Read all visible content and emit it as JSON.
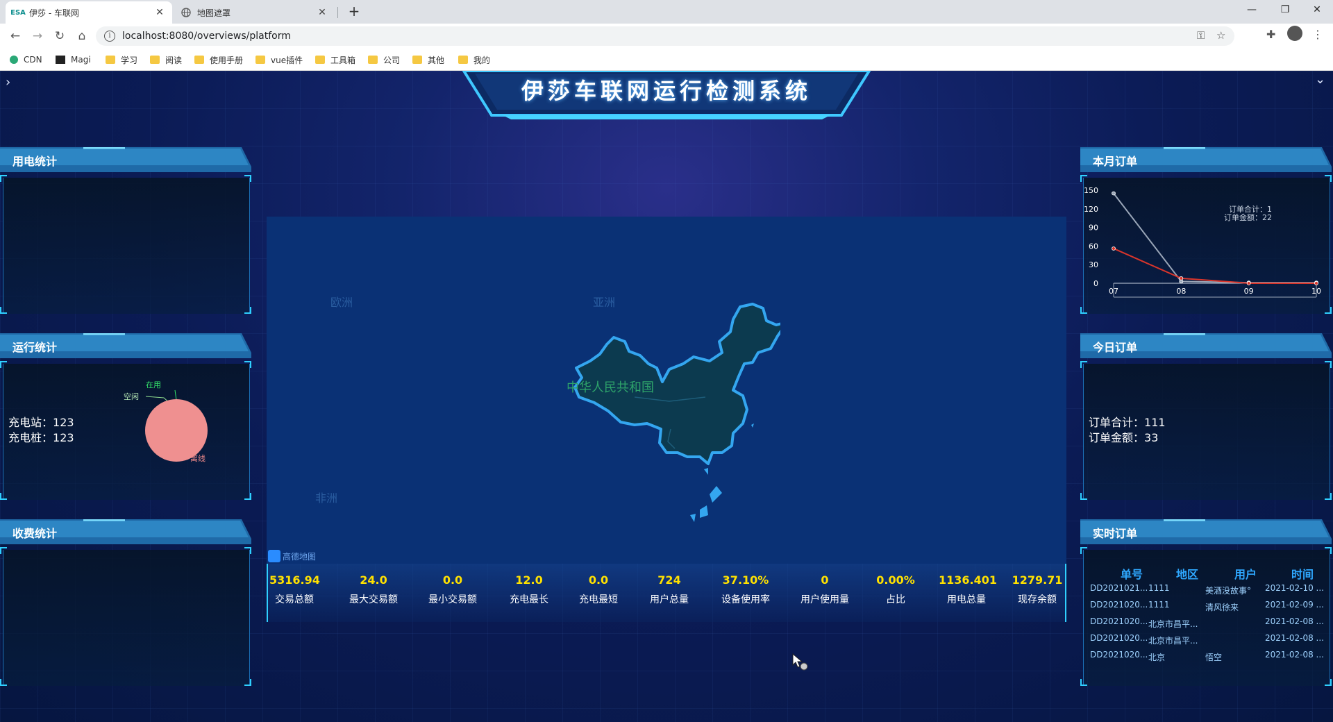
{
  "browser": {
    "tabs": [
      {
        "title": "伊莎 - 车联网",
        "favicon": "app-logo"
      },
      {
        "title": "地图遮罩",
        "favicon": "globe-icon"
      }
    ],
    "url": "localhost:8080/overviews/platform",
    "bookmarks": [
      "CDN",
      "Magi",
      "学习",
      "阅读",
      "使用手册",
      "vue插件",
      "工具箱",
      "公司",
      "其他",
      "我的"
    ]
  },
  "header": {
    "title": "伊莎车联网运行检测系统"
  },
  "panels": {
    "power": {
      "title": "用电统计"
    },
    "run": {
      "title": "运行统计",
      "stations_label": "充电站：",
      "stations": "123",
      "piles_label": "充电桩：",
      "piles": "123",
      "pie_labels": [
        "在用",
        "空闲",
        "离线"
      ]
    },
    "fee": {
      "title": "收费统计"
    },
    "month_orders": {
      "title": "本月订单",
      "tooltip_count": "订单合计：1",
      "tooltip_amount": "订单金额：22"
    },
    "today_orders": {
      "title": "今日订单",
      "count_label": "订单合计：",
      "count": "111",
      "amount_label": "订单金额：",
      "amount": "33"
    },
    "realtime": {
      "title": "实时订单",
      "headers": [
        "单号",
        "地区",
        "用户",
        "时间"
      ],
      "rows": [
        [
          "DD2021021...",
          "1111",
          "美酒没故事°",
          "2021-02-10 ..."
        ],
        [
          "DD2021020...",
          "1111",
          "清风徐来",
          "2021-02-09 ..."
        ],
        [
          "DD2021020...",
          "北京市昌平...",
          "",
          "2021-02-08 ..."
        ],
        [
          "DD2021020...",
          "北京市昌平...",
          "",
          "2021-02-08 ..."
        ],
        [
          "DD2021020...",
          "北京",
          "悟空",
          "2021-02-08 ..."
        ]
      ]
    }
  },
  "map": {
    "country_label": "中华人民共和国",
    "regions": [
      "欧洲",
      "亚洲",
      "非洲"
    ],
    "attribution": "高德地图"
  },
  "stats": [
    {
      "value": "5316.94",
      "label": "交易总额"
    },
    {
      "value": "24.0",
      "label": "最大交易额"
    },
    {
      "value": "0.0",
      "label": "最小交易额"
    },
    {
      "value": "12.0",
      "label": "充电最长"
    },
    {
      "value": "0.0",
      "label": "充电最短"
    },
    {
      "value": "724",
      "label": "用户总量"
    },
    {
      "value": "37.10%",
      "label": "设备使用率"
    },
    {
      "value": "0",
      "label": "用户使用量"
    },
    {
      "value": "0.00%",
      "label": "占比"
    },
    {
      "value": "1136.401",
      "label": "用电总量"
    },
    {
      "value": "1279.71",
      "label": "现存余额"
    }
  ],
  "chart_data": {
    "type": "line",
    "categories": [
      "07",
      "08",
      "09",
      "10"
    ],
    "series": [
      {
        "values": [
          145,
          3,
          1,
          1
        ]
      },
      {
        "values": [
          56,
          8,
          0,
          0
        ]
      }
    ],
    "yticks": [
      "150",
      "120",
      "90",
      "60",
      "30",
      "0"
    ],
    "xticks": [
      "07",
      "08",
      "09",
      "10"
    ],
    "ylim": [
      0,
      150
    ],
    "colors": [
      "#9aa6b8",
      "#d9352b"
    ]
  }
}
